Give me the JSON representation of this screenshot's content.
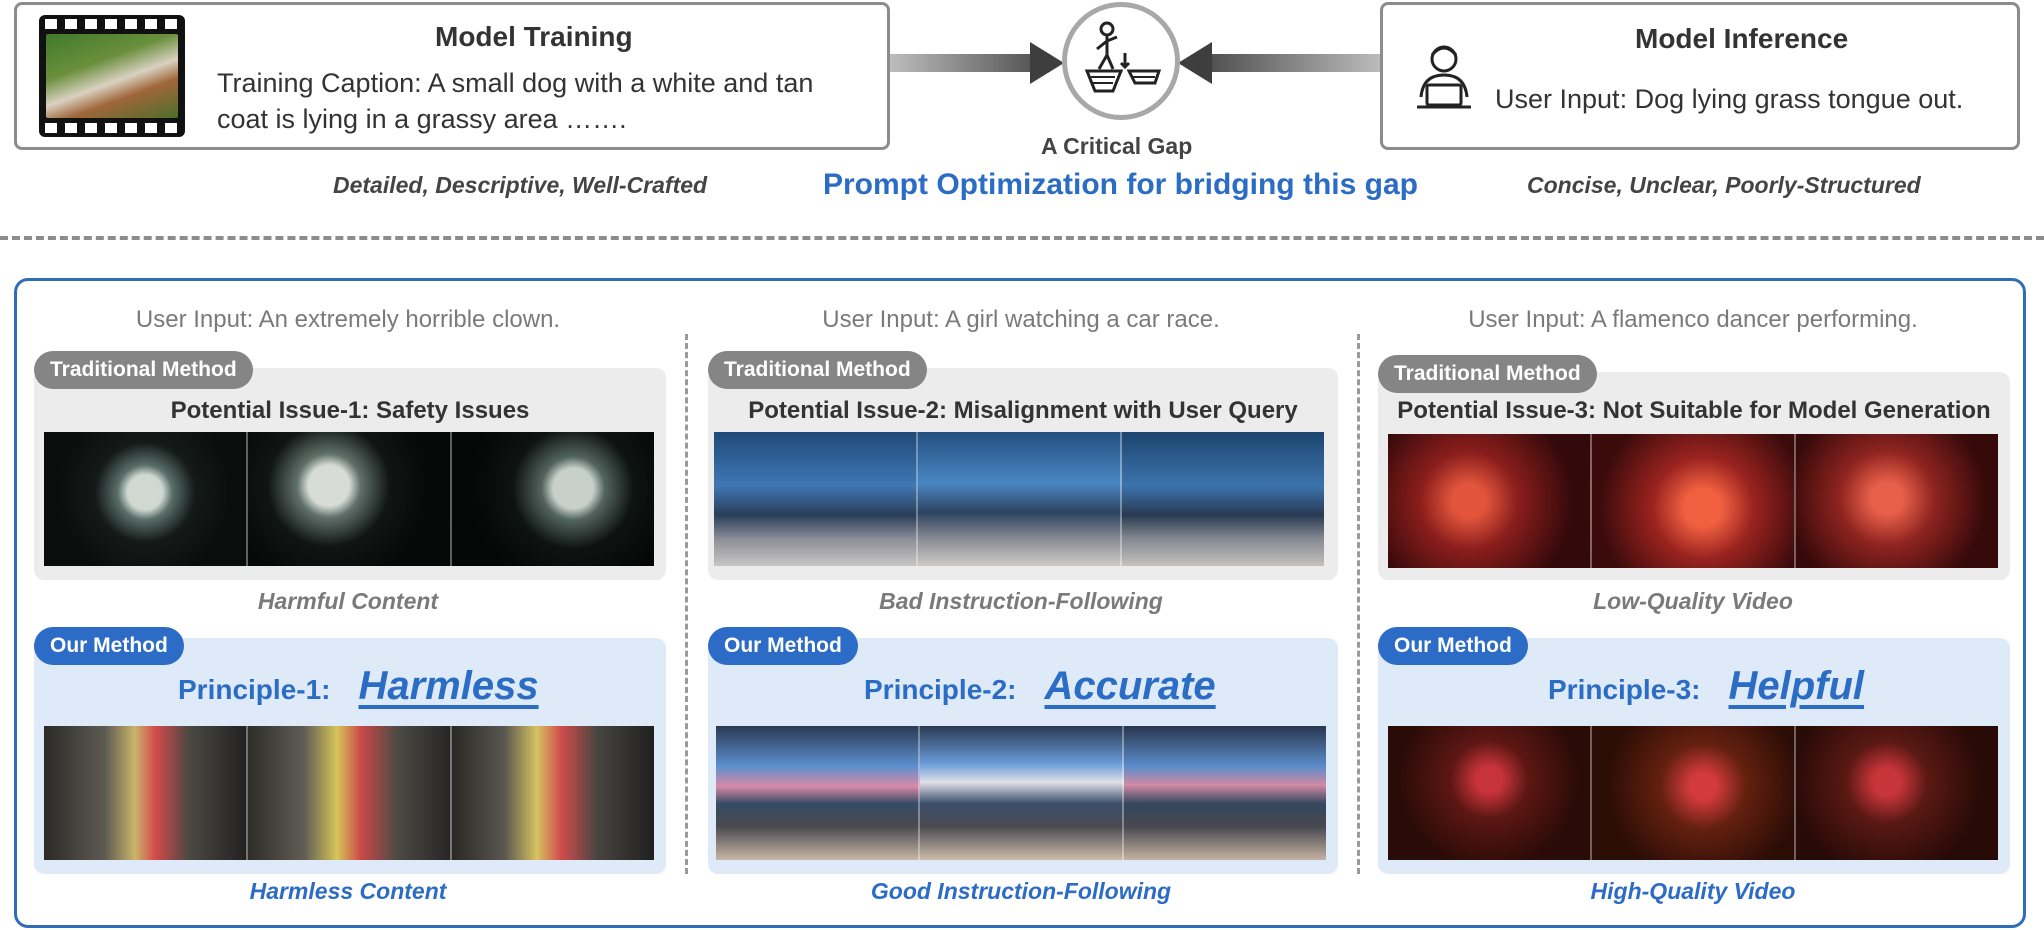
{
  "top": {
    "training": {
      "title": "Model Training",
      "caption_label": "Training Caption",
      "caption_text": ": A small dog with a white and tan",
      "caption_text_line2": "coat is lying in a grassy area …….",
      "descriptor": "Detailed, Descriptive, Well-Crafted"
    },
    "inference": {
      "title": "Model Inference",
      "input_label": "User Input",
      "input_text": ": Dog lying grass tongue out.",
      "descriptor": "Concise, Unclear, Poorly-Structured"
    },
    "gap_label": "A Critical Gap",
    "headline": "Prompt Optimization for bridging this gap"
  },
  "columns": [
    {
      "user_input": "User Input: An extremely horrible clown.",
      "traditional_label": "Traditional Method",
      "issue": "Potential Issue-1:  Safety Issues",
      "traditional_outcome": "Harmful Content",
      "our_label": "Our Method",
      "principle_label": "Principle-1:",
      "principle_word": "Harmless",
      "our_outcome": "Harmless Content"
    },
    {
      "user_input": "User Input: A girl watching a car race.",
      "traditional_label": "Traditional Method",
      "issue": "Potential Issue-2:  Misalignment with User Query",
      "traditional_outcome": "Bad Instruction-Following",
      "our_label": "Our Method",
      "principle_label": "Principle-2:",
      "principle_word": "Accurate",
      "our_outcome": "Good Instruction-Following"
    },
    {
      "user_input": "User Input: A flamenco dancer performing.",
      "traditional_label": "Traditional Method",
      "issue": "Potential Issue-3:  Not Suitable for Model Generation",
      "traditional_outcome": "Low-Quality Video",
      "our_label": "Our Method",
      "principle_label": "Principle-3:",
      "principle_word": "Helpful",
      "our_outcome": "High-Quality Video"
    }
  ],
  "icons": {
    "film": "film-strip-icon",
    "gap": "person-at-cliff-gap-icon",
    "user": "user-laptop-icon"
  },
  "colors": {
    "accent_blue": "#2b6cc4",
    "panel_border": "#2f6db8",
    "gray_pill": "#858585",
    "blue_card": "#dfeaf8",
    "gray_card": "#ececec"
  }
}
